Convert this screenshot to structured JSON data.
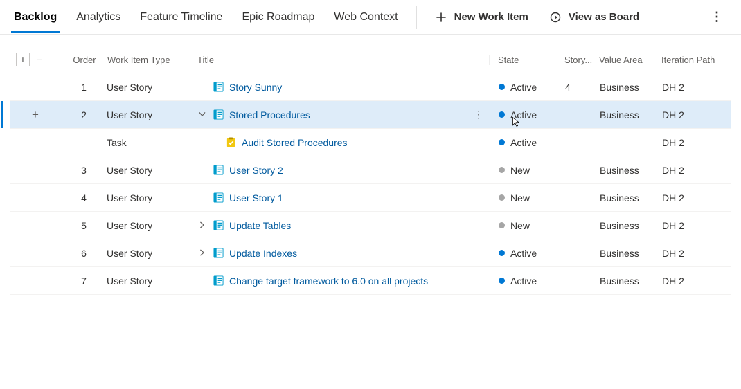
{
  "tabs": [
    "Backlog",
    "Analytics",
    "Feature Timeline",
    "Epic Roadmap",
    "Web Context"
  ],
  "active_tab": 0,
  "top_actions": {
    "new_item": "New Work Item",
    "view_board": "View as Board"
  },
  "columns": {
    "order": "Order",
    "type": "Work Item Type",
    "title": "Title",
    "state": "State",
    "storypoints": "Story...",
    "value": "Value Area",
    "iter": "Iteration Path"
  },
  "rows": [
    {
      "order": "1",
      "type": "User Story",
      "indent": 0,
      "expand": "none",
      "icon": "userstory",
      "title": "Story Sunny",
      "state": "Active",
      "state_kind": "active",
      "story": "4",
      "value": "Business",
      "iter": "DH 2",
      "selected": false
    },
    {
      "order": "2",
      "type": "User Story",
      "indent": 0,
      "expand": "down",
      "icon": "userstory",
      "title": "Stored Procedures",
      "state": "Active",
      "state_kind": "active",
      "story": "",
      "value": "Business",
      "iter": "DH 2",
      "selected": true
    },
    {
      "order": "",
      "type": "Task",
      "indent": 1,
      "expand": "none",
      "icon": "task",
      "title": "Audit Stored Procedures",
      "state": "Active",
      "state_kind": "active",
      "story": "",
      "value": "",
      "iter": "DH 2",
      "selected": false
    },
    {
      "order": "3",
      "type": "User Story",
      "indent": 0,
      "expand": "none",
      "icon": "userstory",
      "title": "User Story 2",
      "state": "New",
      "state_kind": "new",
      "story": "",
      "value": "Business",
      "iter": "DH 2",
      "selected": false
    },
    {
      "order": "4",
      "type": "User Story",
      "indent": 0,
      "expand": "none",
      "icon": "userstory",
      "title": "User Story 1",
      "state": "New",
      "state_kind": "new",
      "story": "",
      "value": "Business",
      "iter": "DH 2",
      "selected": false
    },
    {
      "order": "5",
      "type": "User Story",
      "indent": 0,
      "expand": "right",
      "icon": "userstory",
      "title": "Update Tables",
      "state": "New",
      "state_kind": "new",
      "story": "",
      "value": "Business",
      "iter": "DH 2",
      "selected": false
    },
    {
      "order": "6",
      "type": "User Story",
      "indent": 0,
      "expand": "right",
      "icon": "userstory",
      "title": "Update Indexes",
      "state": "Active",
      "state_kind": "active",
      "story": "",
      "value": "Business",
      "iter": "DH 2",
      "selected": false
    },
    {
      "order": "7",
      "type": "User Story",
      "indent": 0,
      "expand": "none",
      "icon": "userstory",
      "title": "Change target framework to 6.0 on all projects",
      "state": "Active",
      "state_kind": "active",
      "story": "",
      "value": "Business",
      "iter": "DH 2",
      "selected": false
    }
  ],
  "icons": {
    "userstory_color": "#009ccc",
    "task_color": "#f2c811"
  }
}
